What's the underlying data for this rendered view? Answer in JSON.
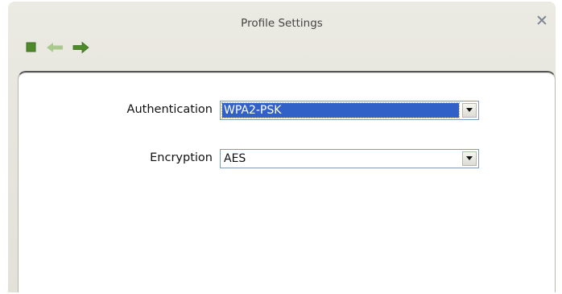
{
  "window": {
    "title": "Profile Settings",
    "close_icon": "close-icon"
  },
  "toolbar": {
    "stop_icon": "stop-icon",
    "back_icon": "back-arrow-icon",
    "forward_icon": "forward-arrow-icon",
    "accent_green": "#4f8a2a",
    "disabled_green": "#a9c98f"
  },
  "form": {
    "authentication": {
      "label": "Authentication",
      "value": "WPA2-PSK"
    },
    "encryption": {
      "label": "Encryption",
      "value": "AES"
    }
  }
}
